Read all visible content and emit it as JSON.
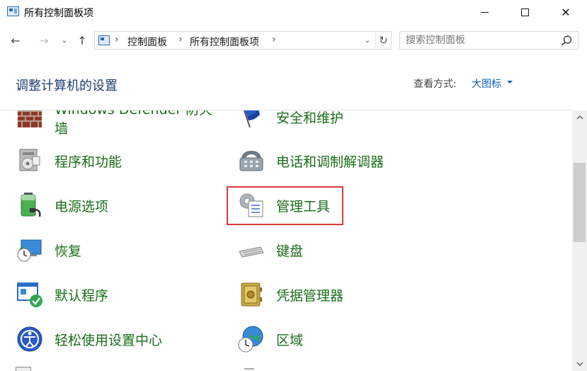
{
  "window": {
    "title": "所有控制面板项",
    "minimize_glyph": "—",
    "close_glyph": "✕"
  },
  "nav": {
    "back_glyph": "←",
    "forward_glyph": "→",
    "recent_glyph": "⌄",
    "up_glyph": "↑",
    "breadcrumbs": [
      "控制面板",
      "所有控制面板项"
    ],
    "separator": "›",
    "dropdown_glyph": "⌄",
    "refresh_glyph": "↻"
  },
  "search": {
    "placeholder": "搜索控制面板"
  },
  "header": {
    "title": "调整计算机的设置",
    "view_label": "查看方式:",
    "view_value": "大图标"
  },
  "items": [
    {
      "label": "Windows Defender 防火",
      "label_line2": "墙",
      "icon": "firewall-icon"
    },
    {
      "label": "安全和维护",
      "icon": "security-flag-icon"
    },
    {
      "label": "程序和功能",
      "icon": "programs-icon"
    },
    {
      "label": "电话和调制解调器",
      "icon": "phone-modem-icon"
    },
    {
      "label": "电源选项",
      "icon": "battery-icon"
    },
    {
      "label": "管理工具",
      "icon": "admin-tools-icon"
    },
    {
      "label": "恢复",
      "icon": "recovery-icon"
    },
    {
      "label": "键盘",
      "icon": "keyboard-icon"
    },
    {
      "label": "默认程序",
      "icon": "default-programs-icon"
    },
    {
      "label": "凭据管理器",
      "icon": "credential-vault-icon"
    },
    {
      "label": "轻松使用设置中心",
      "icon": "ease-of-access-icon"
    },
    {
      "label": "区域",
      "icon": "globe-clock-icon"
    }
  ],
  "colors": {
    "link_green": "#1a6d1a",
    "title_blue": "#1e3f73",
    "highlight_red": "#d93b3b"
  }
}
